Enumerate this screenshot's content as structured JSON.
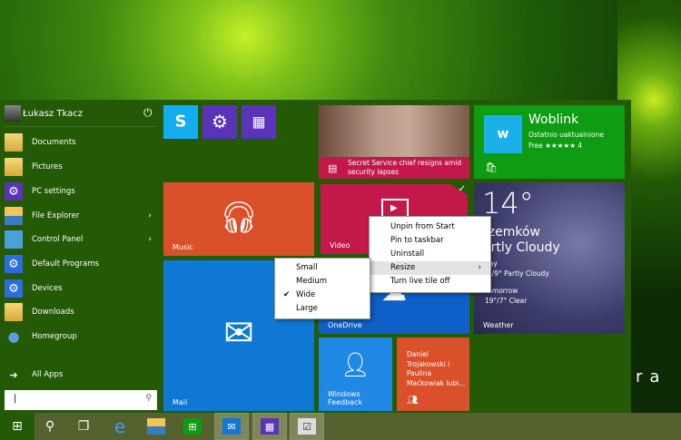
{
  "user": {
    "name": "Łukasz Tkacz",
    "power_icon": "power-icon"
  },
  "left_items": [
    {
      "label": "Documents",
      "icon": "documents-folder-icon",
      "submenu": false
    },
    {
      "label": "Pictures",
      "icon": "pictures-folder-icon",
      "submenu": false
    },
    {
      "label": "PC settings",
      "icon": "gear-icon",
      "submenu": false
    },
    {
      "label": "File Explorer",
      "icon": "file-explorer-icon",
      "submenu": true
    },
    {
      "label": "Control Panel",
      "icon": "control-panel-icon",
      "submenu": true
    },
    {
      "label": "Default Programs",
      "icon": "gear-icon",
      "submenu": false
    },
    {
      "label": "Devices",
      "icon": "gear-icon",
      "submenu": false
    },
    {
      "label": "Downloads",
      "icon": "downloads-folder-icon",
      "submenu": false
    },
    {
      "label": "Homegroup",
      "icon": "homegroup-icon",
      "submenu": false
    }
  ],
  "all_apps": "All Apps",
  "search": {
    "value": "|"
  },
  "tiles": {
    "music": {
      "label": "Music",
      "color": "#d9502a"
    },
    "mail": {
      "label": "Mail",
      "color": "#0f78d4"
    },
    "news": {
      "headline": "Secret Service chief resigns amid security lapses",
      "color": "#c2194a"
    },
    "woblink": {
      "title": "Woblink",
      "subtitle": "Ostatnio uaktualnione",
      "rating": "Free ★★★★★ 4",
      "color": "#0d9c12"
    },
    "video": {
      "label": "Video",
      "color": "#c2194a"
    },
    "onedrive": {
      "label": "OneDrive",
      "color": "#0f5fc9"
    },
    "weather": {
      "temp": "14°",
      "city": "rzemków",
      "condition": "artly Cloudy",
      "today_label": "day",
      "today": "°/9° Partly Cloudy",
      "tomorrow_label": "Tomorrow",
      "tomorrow": "19°/7° Clear",
      "label": "Weather"
    },
    "feedback": {
      "label": "Windows Feedback",
      "color": "#1f88e5"
    },
    "people": {
      "text": "Daniel Trojakowski i Paulina Maćkowiak lubi...",
      "color": "#d9502a"
    }
  },
  "context_menu": [
    {
      "label": "Unpin from Start"
    },
    {
      "label": "Pin to taskbar"
    },
    {
      "label": "Uninstall"
    },
    {
      "label": "Resize",
      "highlighted": true,
      "submenu": true
    },
    {
      "label": "Turn live tile off"
    }
  ],
  "resize_menu": [
    {
      "label": "Small",
      "checked": false
    },
    {
      "label": "Medium",
      "checked": false
    },
    {
      "label": "Wide",
      "checked": true
    },
    {
      "label": "Large",
      "checked": false
    }
  ],
  "wallpaper_text": "ra",
  "taskbar": [
    "start",
    "search",
    "task-view",
    "internet-explorer",
    "file-explorer",
    "store",
    "mail",
    "calendar",
    "app"
  ]
}
